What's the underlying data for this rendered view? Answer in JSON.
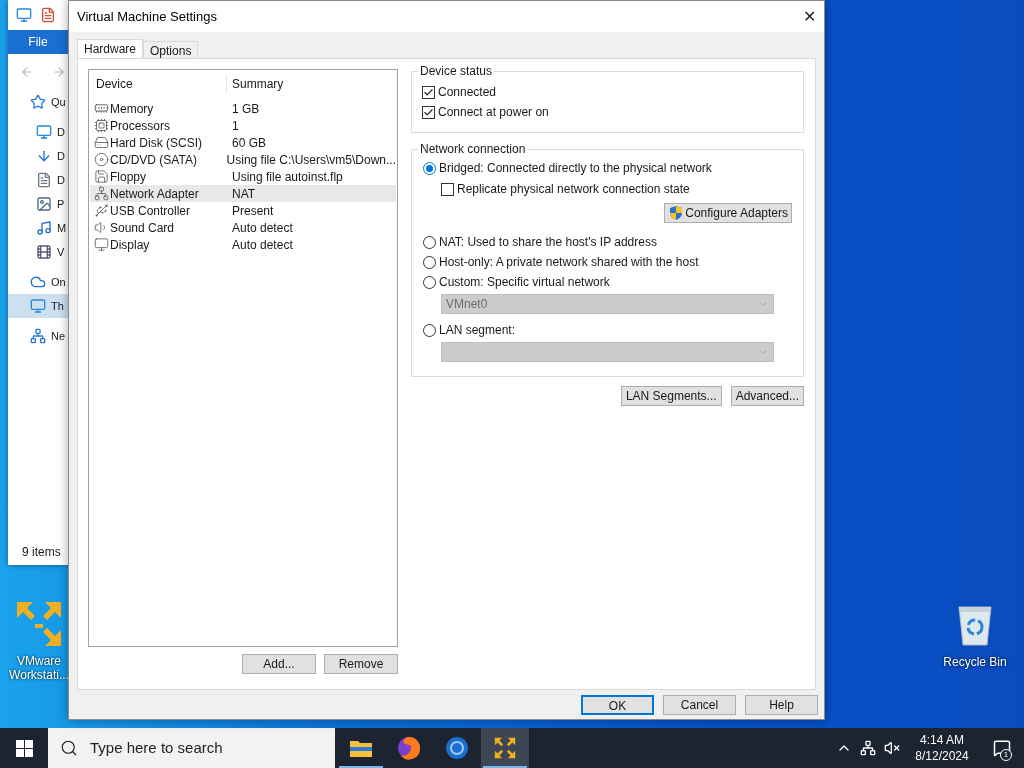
{
  "explorer": {
    "menu_tab": "File",
    "nav_items": [
      {
        "label": "Qu",
        "selected": false
      },
      {
        "label": "D",
        "selected": false
      },
      {
        "label": "D",
        "selected": false
      },
      {
        "label": "D",
        "selected": false
      },
      {
        "label": "P",
        "selected": false
      },
      {
        "label": "M",
        "selected": false
      },
      {
        "label": "V",
        "selected": false
      },
      {
        "label": "On",
        "selected": false
      },
      {
        "label": "Th",
        "selected": true
      },
      {
        "label": "Ne",
        "selected": false
      }
    ],
    "status": "9 items"
  },
  "desktop_icons": [
    {
      "label": "VMware Workstati..."
    },
    {
      "label": "Recycle Bin"
    }
  ],
  "dialog": {
    "title": "Virtual Machine Settings",
    "close": "✕",
    "tabs": [
      {
        "label": "Hardware",
        "selected": true
      },
      {
        "label": "Options",
        "selected": false
      }
    ],
    "device_table": {
      "columns": [
        "Device",
        "Summary"
      ],
      "rows": [
        {
          "device": "Memory",
          "summary": "1 GB",
          "selected": false
        },
        {
          "device": "Processors",
          "summary": "1",
          "selected": false
        },
        {
          "device": "Hard Disk (SCSI)",
          "summary": "60 GB",
          "selected": false
        },
        {
          "device": "CD/DVD (SATA)",
          "summary": "Using file C:\\Users\\vm5\\Down...",
          "selected": false
        },
        {
          "device": "Floppy",
          "summary": "Using file autoinst.flp",
          "selected": false
        },
        {
          "device": "Network Adapter",
          "summary": "NAT",
          "selected": true
        },
        {
          "device": "USB Controller",
          "summary": "Present",
          "selected": false
        },
        {
          "device": "Sound Card",
          "summary": "Auto detect",
          "selected": false
        },
        {
          "device": "Display",
          "summary": "Auto detect",
          "selected": false
        }
      ]
    },
    "list_buttons": [
      "Add...",
      "Remove"
    ],
    "device_status": {
      "title": "Device status",
      "checkboxes": [
        {
          "label": "Connected",
          "checked": true
        },
        {
          "label": "Connect at power on",
          "checked": true
        }
      ]
    },
    "network_connection": {
      "title": "Network connection",
      "items": [
        {
          "kind": "radio",
          "label": "Bridged: Connected directly to the physical network",
          "selected": true
        },
        {
          "kind": "checkbox",
          "label": "Replicate physical network connection state",
          "checked": false
        },
        {
          "kind": "button",
          "label": "Configure Adapters"
        },
        {
          "kind": "radio",
          "label": "NAT: Used to share the host's IP address",
          "selected": false
        },
        {
          "kind": "radio",
          "label": "Host-only: A private network shared with the host",
          "selected": false
        },
        {
          "kind": "radio",
          "label": "Custom: Specific virtual network",
          "selected": false
        },
        {
          "kind": "dropdown",
          "value": "VMnet0",
          "disabled": true
        },
        {
          "kind": "radio",
          "label": "LAN segment:",
          "selected": false
        },
        {
          "kind": "dropdown",
          "disabled": true
        }
      ]
    },
    "network_buttons": [
      "LAN Segments...",
      "Advanced..."
    ],
    "footer_buttons": [
      {
        "label": "OK",
        "default": true
      },
      {
        "label": "Cancel",
        "default": false
      },
      {
        "label": "Help",
        "default": false
      }
    ]
  },
  "taskbar": {
    "search_placeholder": "Type here to search",
    "apps": [
      {
        "running": true,
        "active": false
      },
      {
        "running": false,
        "active": false
      },
      {
        "running": false,
        "active": false
      },
      {
        "running": true,
        "active": true
      }
    ],
    "time": "4:14 AM",
    "date": "8/12/2024",
    "notification_count": "1"
  }
}
